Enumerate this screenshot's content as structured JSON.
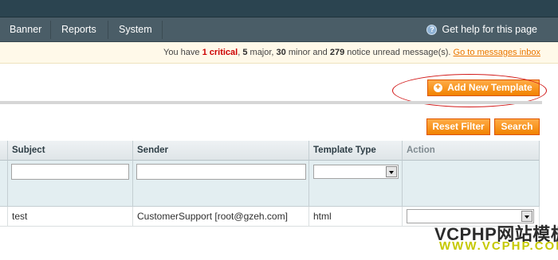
{
  "nav": {
    "items": [
      {
        "label": "Banner"
      },
      {
        "label": "Reports"
      },
      {
        "label": "System"
      }
    ],
    "help_label": "Get help for this page"
  },
  "notice": {
    "prefix": "You have ",
    "critical_count": "1",
    "critical_label": " critical",
    "sep1": ", ",
    "major_count": "5",
    "major_label": " major, ",
    "minor_count": "30",
    "minor_label": " minor and ",
    "notice_count": "279",
    "notice_label": " notice unread message(s). ",
    "link": "Go to messages inbox"
  },
  "actions": {
    "add_new_template": "Add New Template",
    "reset_filter": "Reset Filter",
    "search": "Search"
  },
  "grid": {
    "columns": [
      "Subject",
      "Sender",
      "Template Type",
      "Action"
    ],
    "filters": {
      "subject": "",
      "sender": "",
      "template_type": ""
    },
    "rows": [
      {
        "subject": "test",
        "sender": "CustomerSupport [root@gzeh.com]",
        "template_type": "html",
        "action": ""
      }
    ]
  },
  "watermark": {
    "line1": "VCPHP网站模板",
    "line2": "WWW.VCPHP.COM"
  }
}
